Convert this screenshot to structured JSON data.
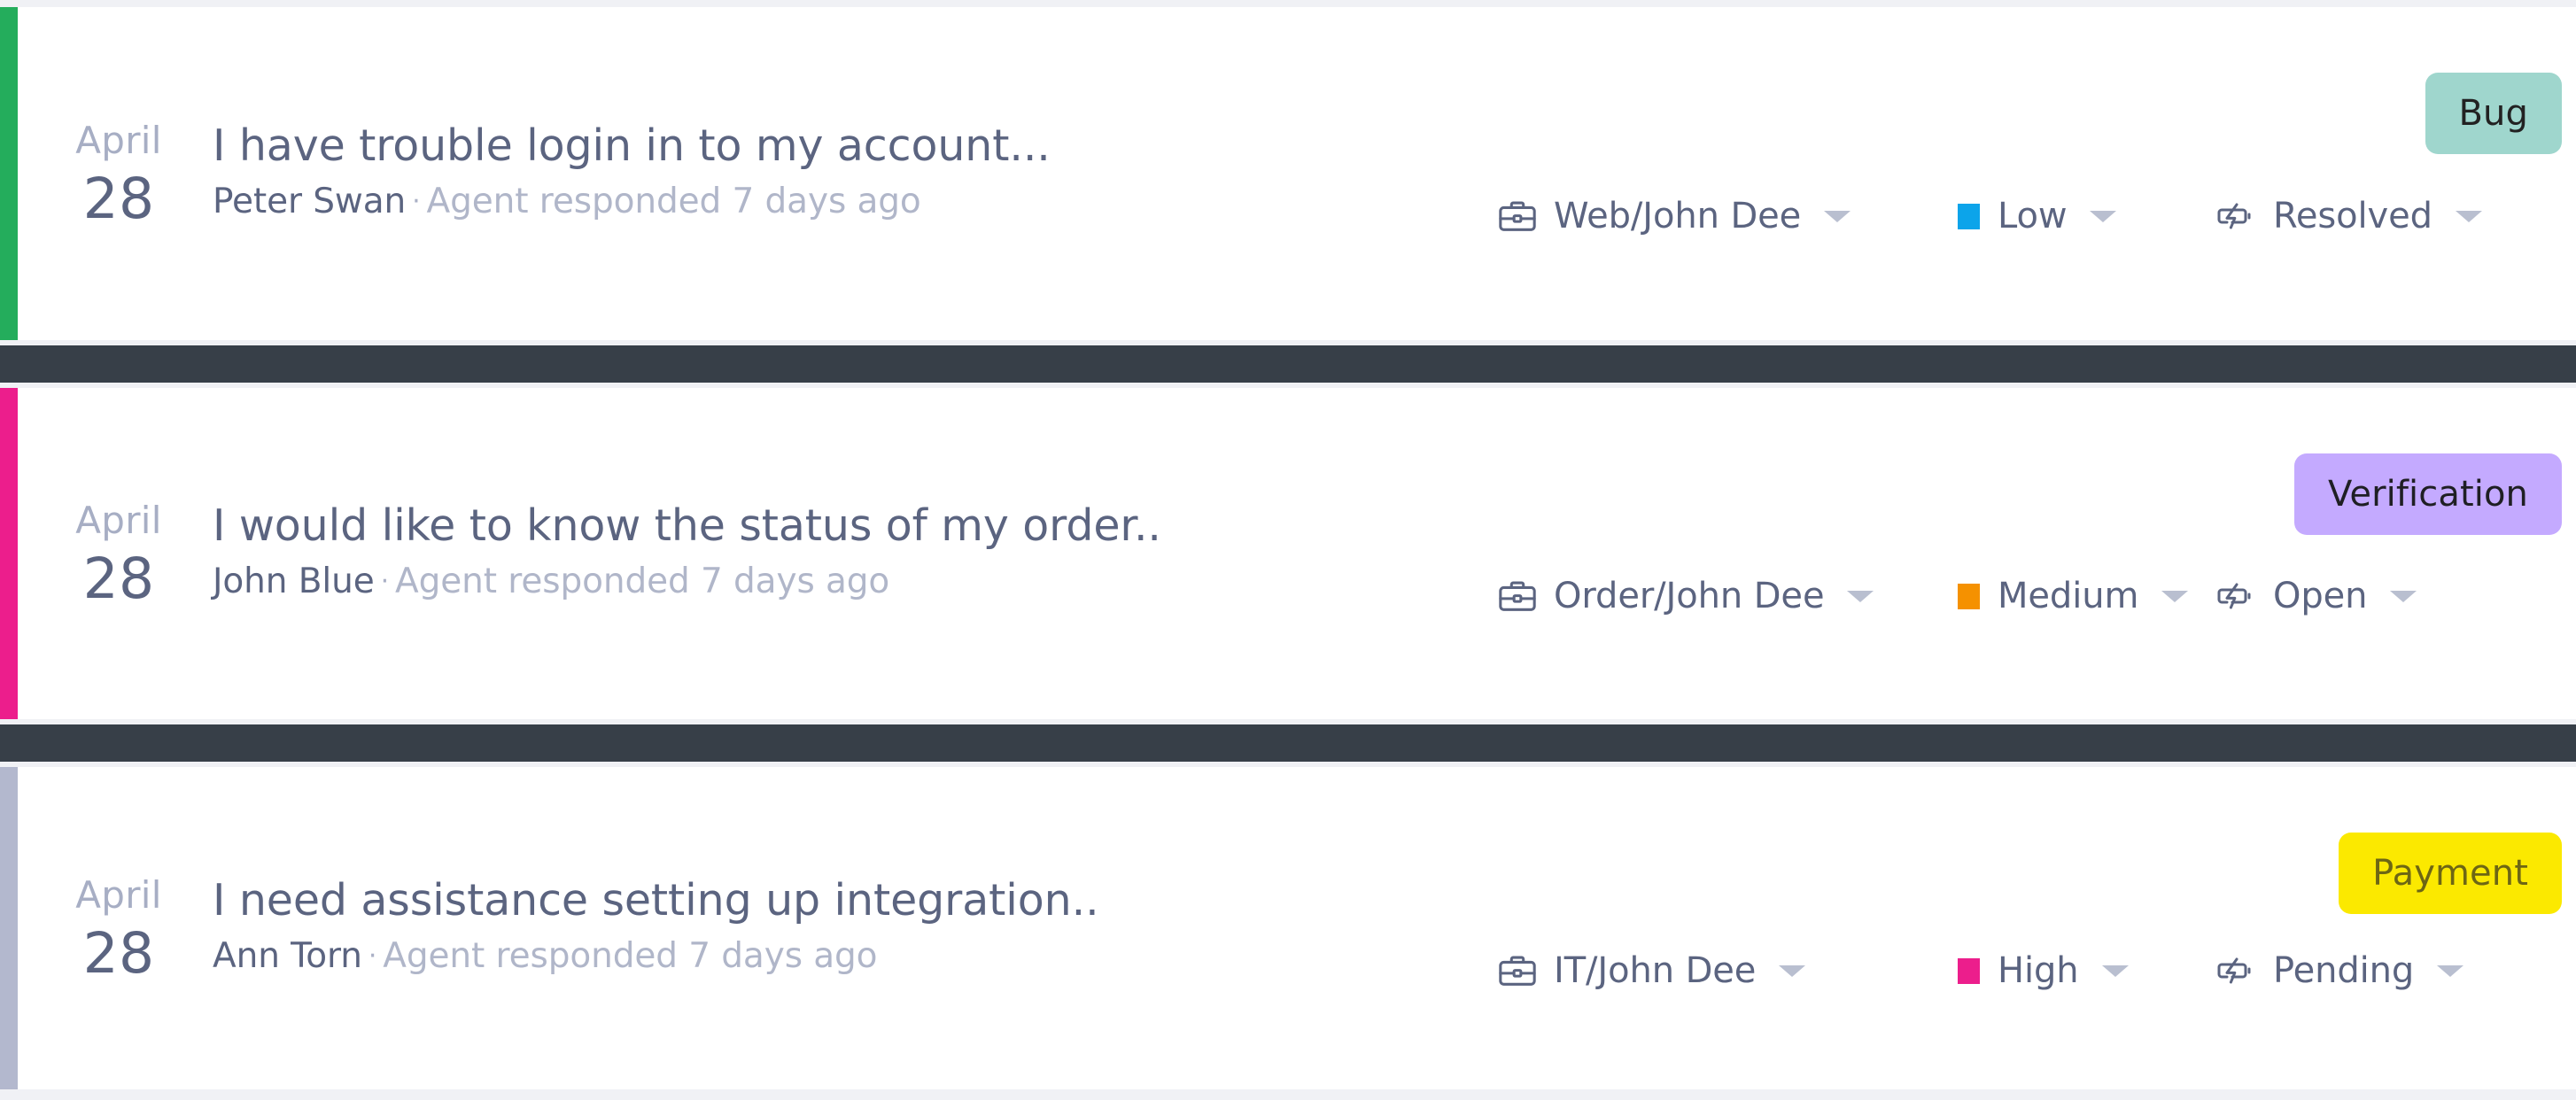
{
  "theme": {
    "page_background": "#f0f1f5",
    "row_background": "#ffffff",
    "separator_color": "#373f48",
    "text_primary": "#5b6480",
    "text_muted": "#b0b6c9",
    "caret_color": "#b9bfd0"
  },
  "tickets": [
    {
      "accent_color": "#24ad5c",
      "date": {
        "month": "April",
        "day": "28"
      },
      "subject": "I have trouble login in to my account...",
      "author": "Peter Swan",
      "separator_dot": "·",
      "activity": "Agent responded 7 days ago",
      "badge": {
        "label": "Bug",
        "background": "#9fd6cd",
        "color": "#222222"
      },
      "department": {
        "icon": "briefcase-icon",
        "label": "Web/John Dee"
      },
      "priority": {
        "label": "Low",
        "color": "#0ca4ea"
      },
      "status": {
        "icon": "battery-charging-icon",
        "label": "Resolved"
      }
    },
    {
      "accent_color": "#ec1e8c",
      "date": {
        "month": "April",
        "day": "28"
      },
      "subject": "I would like to know the status of my order..",
      "author": "John Blue",
      "separator_dot": "·",
      "activity": "Agent responded 7 days ago",
      "badge": {
        "label": "Verification",
        "background": "#c4aaff",
        "color": "#1f1f24"
      },
      "department": {
        "icon": "briefcase-icon",
        "label": "Order/John Dee"
      },
      "priority": {
        "label": "Medium",
        "color": "#f59100"
      },
      "status": {
        "icon": "battery-charging-icon",
        "label": "Open"
      }
    },
    {
      "accent_color": "#b3b8ce",
      "date": {
        "month": "April",
        "day": "28"
      },
      "subject": "I need assistance setting up integration..",
      "author": "Ann Torn",
      "separator_dot": "·",
      "activity": "Agent responded 7 days ago",
      "badge": {
        "label": "Payment",
        "background": "#fbe900",
        "color": "#6d6614"
      },
      "department": {
        "icon": "briefcase-icon",
        "label": "IT/John Dee"
      },
      "priority": {
        "label": "High",
        "color": "#ec1e8c"
      },
      "status": {
        "icon": "battery-charging-icon",
        "label": "Pending"
      }
    }
  ]
}
